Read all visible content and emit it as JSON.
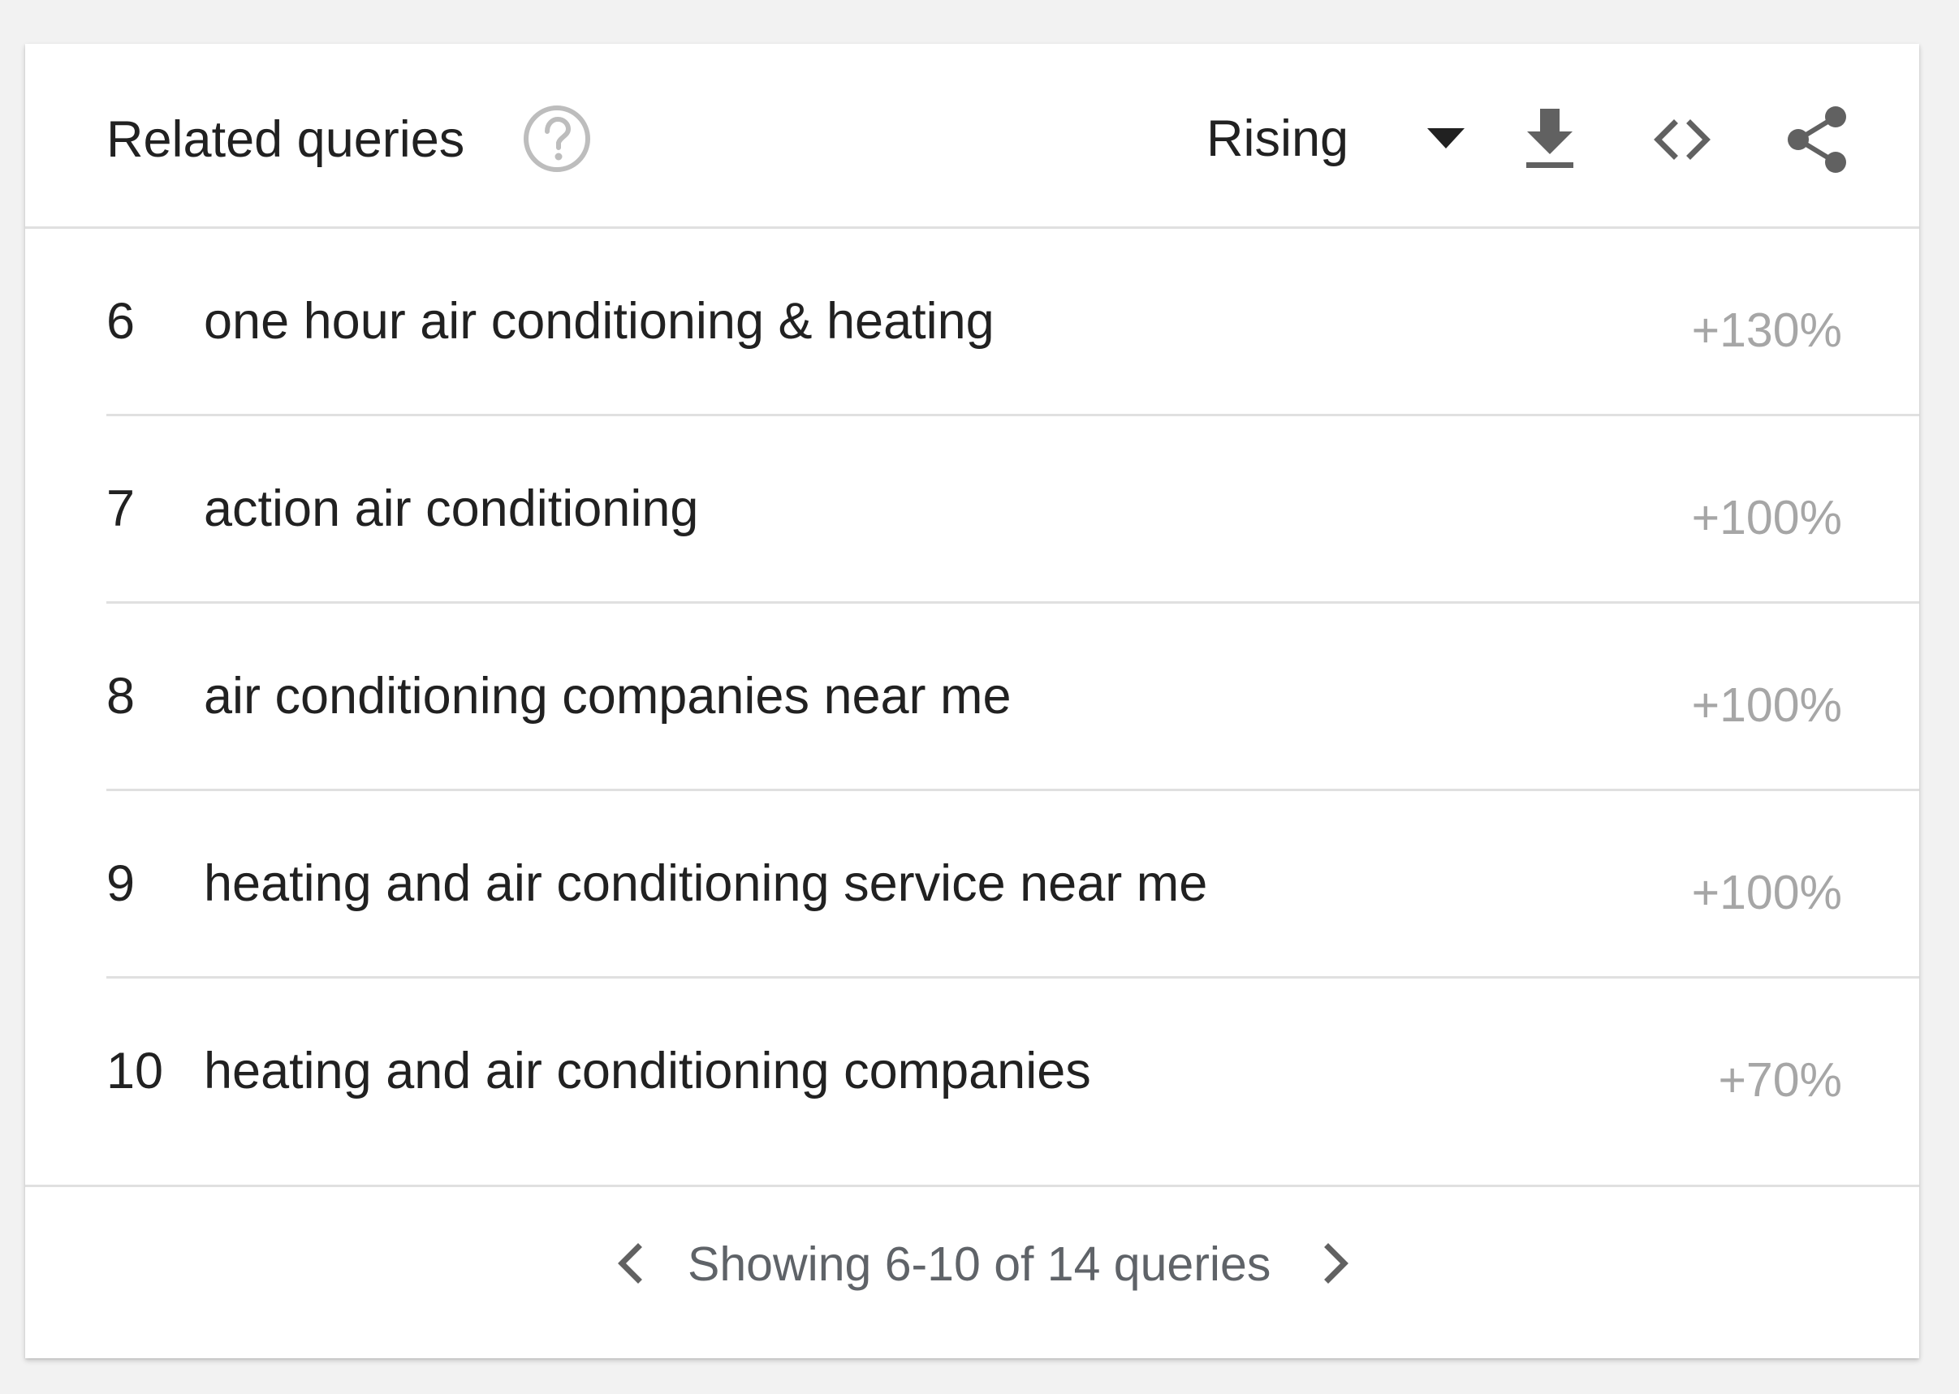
{
  "header": {
    "title": "Related queries",
    "help_icon": "help-circle-icon",
    "sort": {
      "selected": "Rising",
      "caret_icon": "caret-down-icon"
    },
    "actions": {
      "download_icon": "download-icon",
      "embed_icon": "code-embed-icon",
      "share_icon": "share-icon"
    }
  },
  "queries": [
    {
      "rank": "6",
      "query": "one hour air conditioning & heating",
      "change": "+130%"
    },
    {
      "rank": "7",
      "query": "action air conditioning",
      "change": "+100%"
    },
    {
      "rank": "8",
      "query": "air conditioning companies near me",
      "change": "+100%"
    },
    {
      "rank": "9",
      "query": "heating and air conditioning service near me",
      "change": "+100%"
    },
    {
      "rank": "10",
      "query": "heating and air conditioning companies",
      "change": "+70%"
    }
  ],
  "pagination": {
    "text": "Showing 6-10 of 14 queries",
    "prev_icon": "chevron-left-icon",
    "next_icon": "chevron-right-icon"
  },
  "colors": {
    "text_primary": "#212121",
    "text_muted": "#a6a6a6",
    "icon": "#616161",
    "divider": "#e0e0e0",
    "background": "#f2f2f2",
    "card": "#ffffff"
  }
}
